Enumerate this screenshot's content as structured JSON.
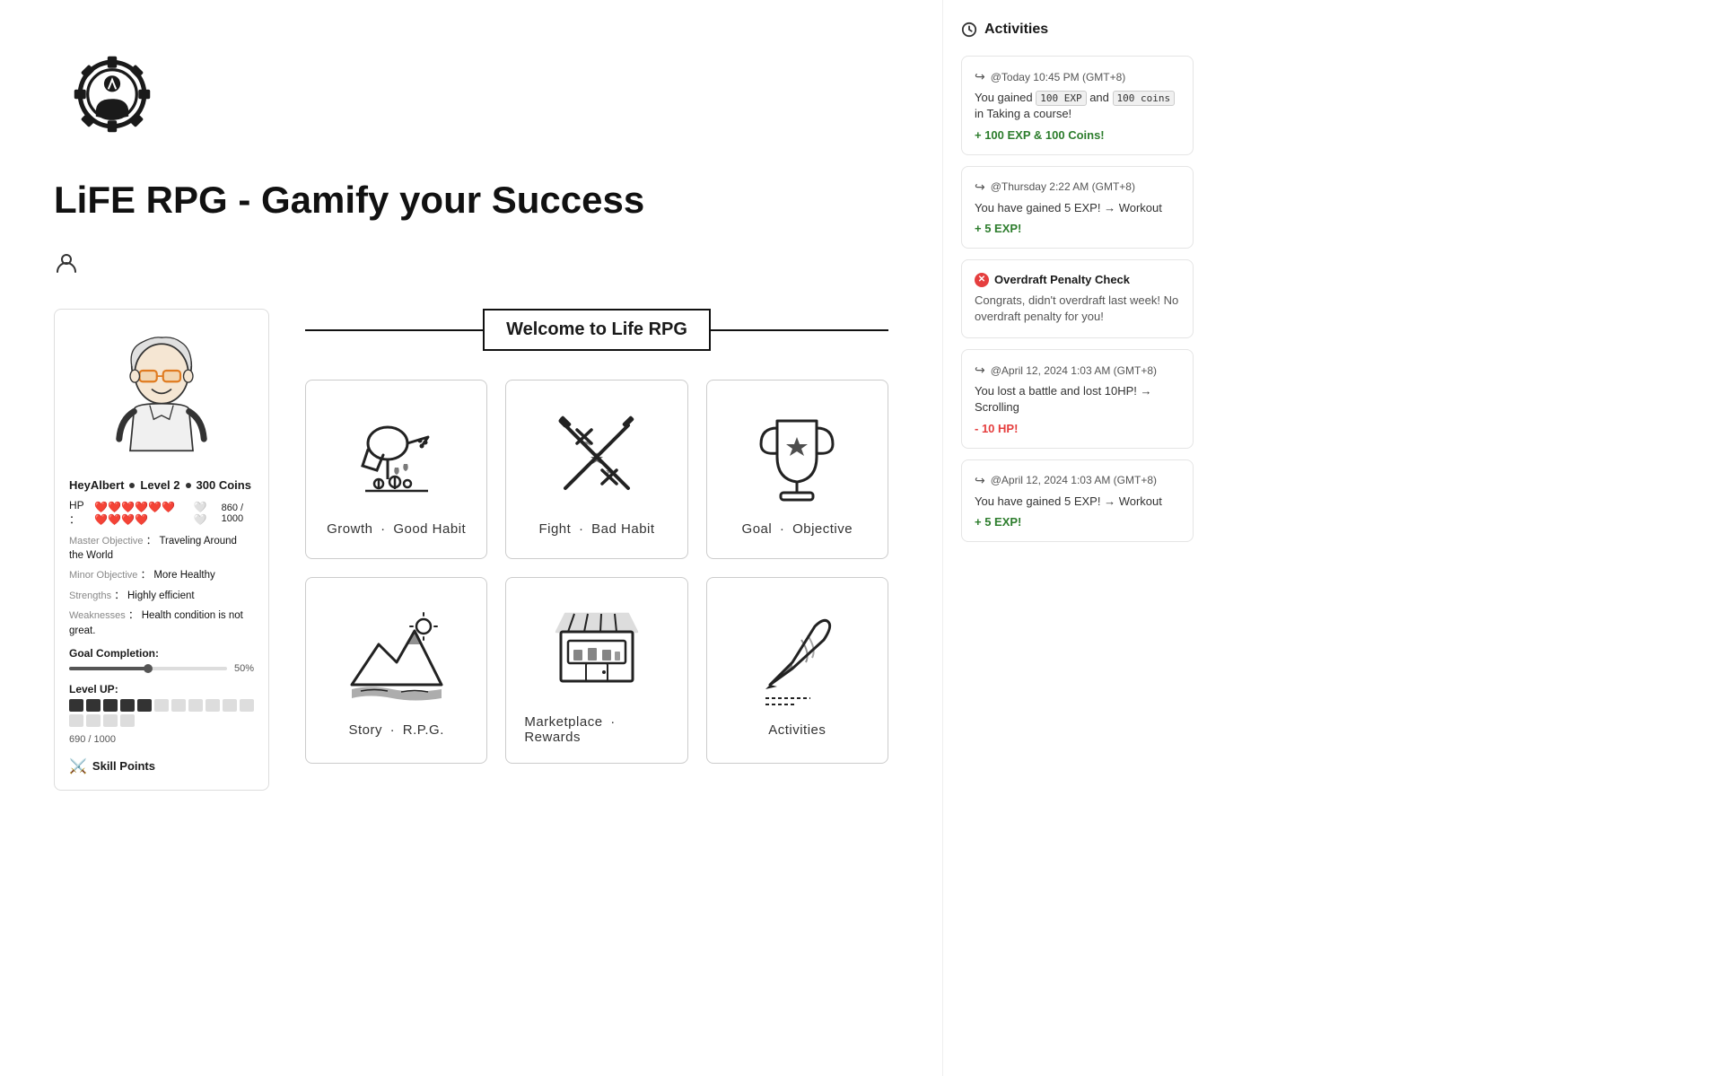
{
  "page": {
    "title": "LiFE RPG - Gamify your Success"
  },
  "character": {
    "name": "HeyAlbert",
    "level": "Level 2",
    "coins": "300 Coins",
    "hp_current": 860,
    "hp_max": 1000,
    "hp_filled": 10,
    "hp_empty": 2,
    "master_objective_label": "Master Objective",
    "master_objective": "Traveling Around the World",
    "minor_objective_label": "Minor Objective",
    "minor_objective": "More Healthy",
    "strengths_label": "Strengths",
    "strengths": "Highly efficient",
    "weaknesses_label": "Weaknesses",
    "weaknesses": "Health condition is not great.",
    "goal_completion_label": "Goal Completion:",
    "goal_percent": "50%",
    "goal_fill": 50,
    "level_up_label": "Level UP:",
    "level_current": 690,
    "level_max": 1000,
    "level_text": "690 / 1000",
    "level_filled": 5,
    "level_empty": 10,
    "skill_points_label": "Skill Points"
  },
  "welcome": {
    "title": "Welcome to Life RPG"
  },
  "cards": [
    {
      "id": "growth-good-habit",
      "label_prefix": "Growth",
      "label_suffix": "Good Habit",
      "icon": "watering-can"
    },
    {
      "id": "fight-bad-habit",
      "label_prefix": "Fight",
      "label_suffix": "Bad Habit",
      "icon": "crossed-swords"
    },
    {
      "id": "goal-objective",
      "label_prefix": "Goal",
      "label_suffix": "Objective",
      "icon": "trophy"
    },
    {
      "id": "story",
      "label_prefix": "Story",
      "label_suffix": "R.P.G.",
      "icon": "mountain"
    },
    {
      "id": "marketplace",
      "label_prefix": "Marketplace",
      "label_suffix": "Rewards",
      "icon": "market"
    },
    {
      "id": "activities",
      "label_prefix": "Activities",
      "label_suffix": "",
      "icon": "pen"
    }
  ],
  "activities": {
    "title": "Activities",
    "items": [
      {
        "type": "gain",
        "time": "@Today 10:45 PM (GMT+8)",
        "desc_before": "You gained",
        "exp_badge": "100 EXP",
        "middle": "and",
        "coins_badge": "100 coins",
        "desc_after": "in Taking a course!",
        "reward": "+ 100 EXP & 100 Coins!"
      },
      {
        "type": "gain",
        "time": "@Thursday 2:22 AM (GMT+8)",
        "desc": "You have gained 5 EXP!  →  Workout",
        "reward": "+ 5 EXP!"
      },
      {
        "type": "overdraft",
        "title": "Overdraft Penalty Check",
        "desc": "Congrats, didn't overdraft last week! No overdraft penalty for you!"
      },
      {
        "type": "loss",
        "time": "@April 12, 2024 1:03 AM (GMT+8)",
        "desc": "You lost a battle and lost 10HP!  →  Scrolling",
        "reward": "- 10 HP!"
      },
      {
        "type": "gain",
        "time": "@April 12, 2024 1:03 AM (GMT+8)",
        "desc": "You have gained 5 EXP!  →  Workout",
        "reward": "+ 5 EXP!"
      }
    ]
  }
}
